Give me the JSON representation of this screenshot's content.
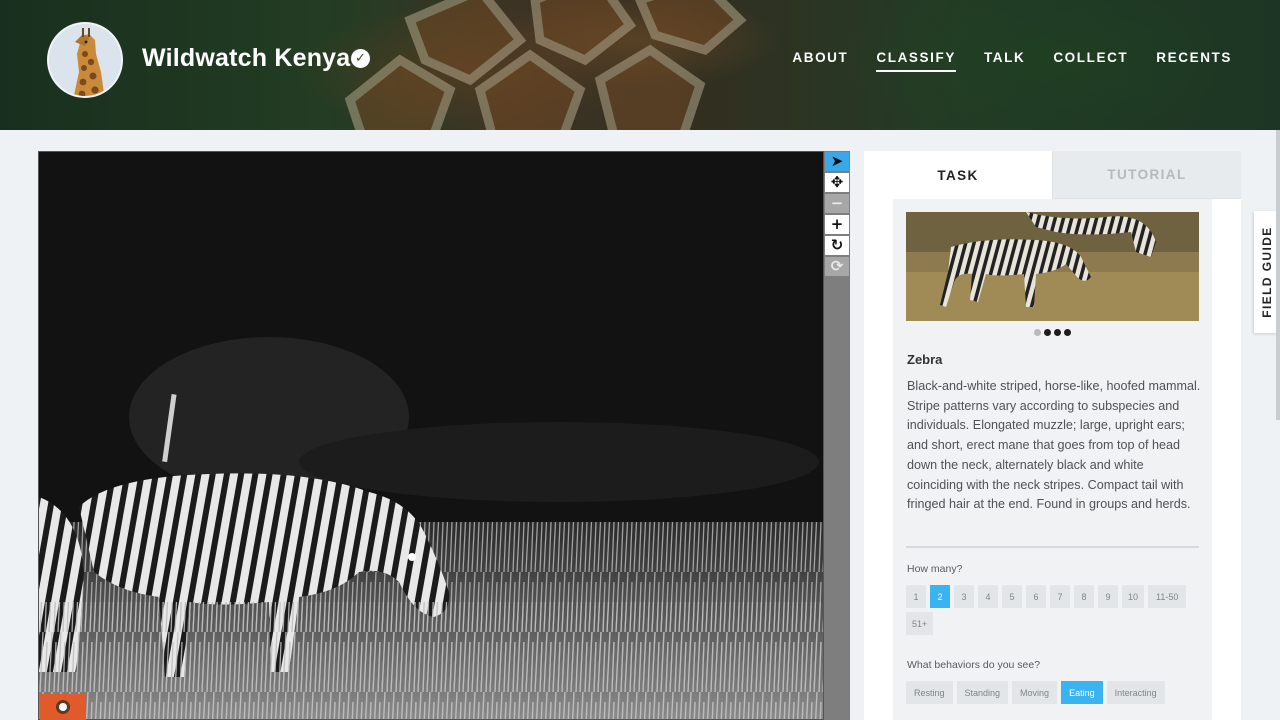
{
  "header": {
    "project_title": "Wildwatch Kenya",
    "verified_icon": "check-circle-icon",
    "nav": [
      {
        "label": "ABOUT",
        "active": false
      },
      {
        "label": "CLASSIFY",
        "active": true
      },
      {
        "label": "TALK",
        "active": false
      },
      {
        "label": "COLLECT",
        "active": false
      },
      {
        "label": "RECENTS",
        "active": false
      }
    ]
  },
  "viewer_tools": [
    {
      "icon": "pointer-icon",
      "glyph": "➤",
      "state": "active"
    },
    {
      "icon": "move-icon",
      "glyph": "✥",
      "state": "normal"
    },
    {
      "icon": "zoom-out-icon",
      "glyph": "−",
      "state": "disabled"
    },
    {
      "icon": "zoom-in-icon",
      "glyph": "+",
      "state": "normal"
    },
    {
      "icon": "rotate-icon",
      "glyph": "↻",
      "state": "normal"
    },
    {
      "icon": "reset-icon",
      "glyph": "⟳",
      "state": "disabled"
    }
  ],
  "panel": {
    "tabs": [
      {
        "label": "TASK",
        "active": true
      },
      {
        "label": "TUTORIAL",
        "active": false
      }
    ],
    "carousel_dots": [
      false,
      true,
      true,
      true
    ],
    "species_name": "Zebra",
    "species_description": "Black-and-white striped, horse-like, hoofed mammal. Stripe patterns vary according to subspecies and individuals. Elongated muzzle; large, upright ears; and short, erect mane that goes from top of head down the neck, alternately black and white coinciding with the neck stripes. Compact tail with fringed hair at the end. Found in groups and herds.",
    "how_many": {
      "label": "How many?",
      "options": [
        "1",
        "2",
        "3",
        "4",
        "5",
        "6",
        "7",
        "8",
        "9",
        "10",
        "11-50",
        "51+"
      ],
      "selected": "2"
    },
    "behaviors": {
      "label": "What behaviors do you see?",
      "options": [
        "Resting",
        "Standing",
        "Moving",
        "Eating",
        "Interacting"
      ],
      "selected": "Eating"
    }
  },
  "field_guide": {
    "label": "FIELD GUIDE"
  },
  "colors": {
    "accent": "#39b4f0",
    "metadata_button": "#e15a2b",
    "tool_active": "#39a7e8"
  }
}
